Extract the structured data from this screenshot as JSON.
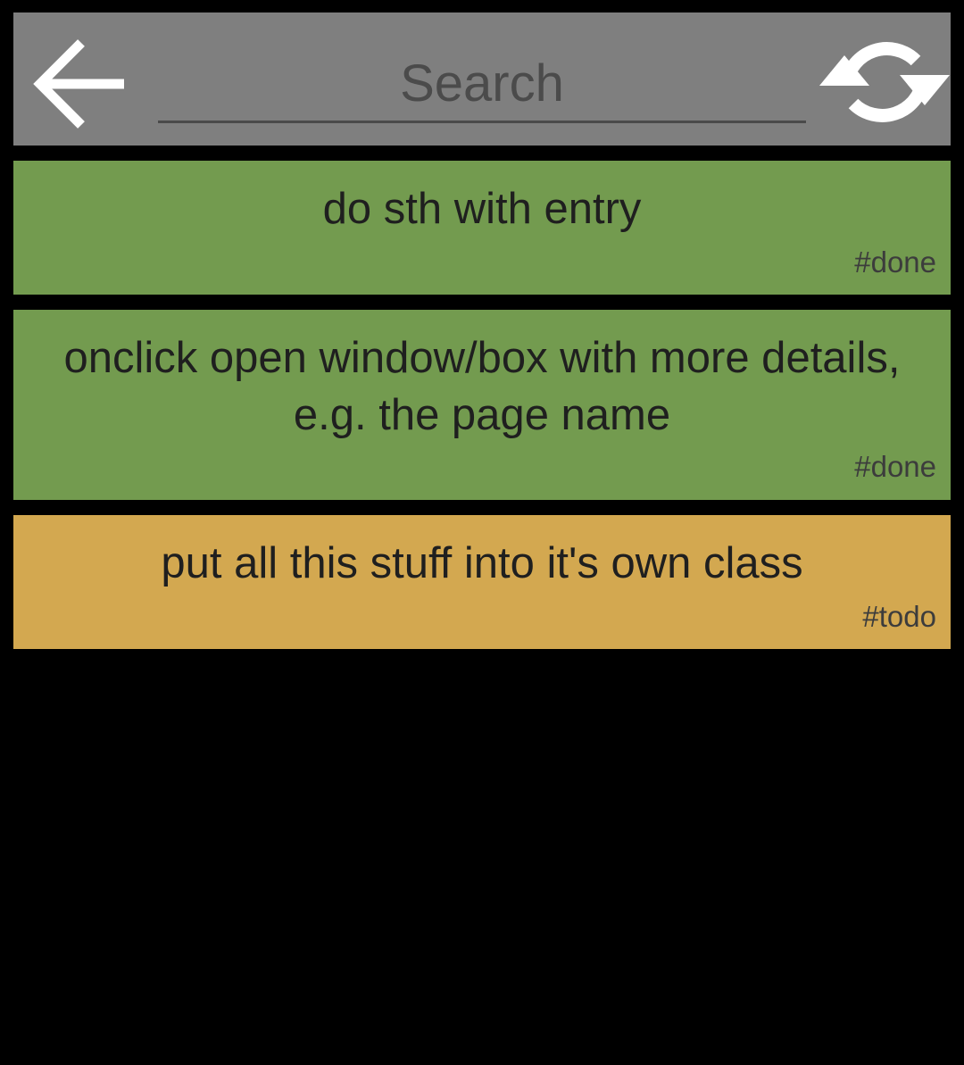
{
  "toolbar": {
    "back_icon": "arrow-left-icon",
    "search_placeholder": "Search",
    "search_value": "",
    "refresh_icon": "refresh-icon"
  },
  "colors": {
    "toolbar_bg": "#7f7f7f",
    "done": "#739b4f",
    "todo": "#d3a850",
    "background": "#000000"
  },
  "entries": [
    {
      "text": "do sth with entry",
      "tag": "#done",
      "status": "done"
    },
    {
      "text": "onclick open window/box with more details, e.g. the page name",
      "tag": "#done",
      "status": "done"
    },
    {
      "text": "put all this stuff into it's own class",
      "tag": "#todo",
      "status": "todo"
    }
  ]
}
